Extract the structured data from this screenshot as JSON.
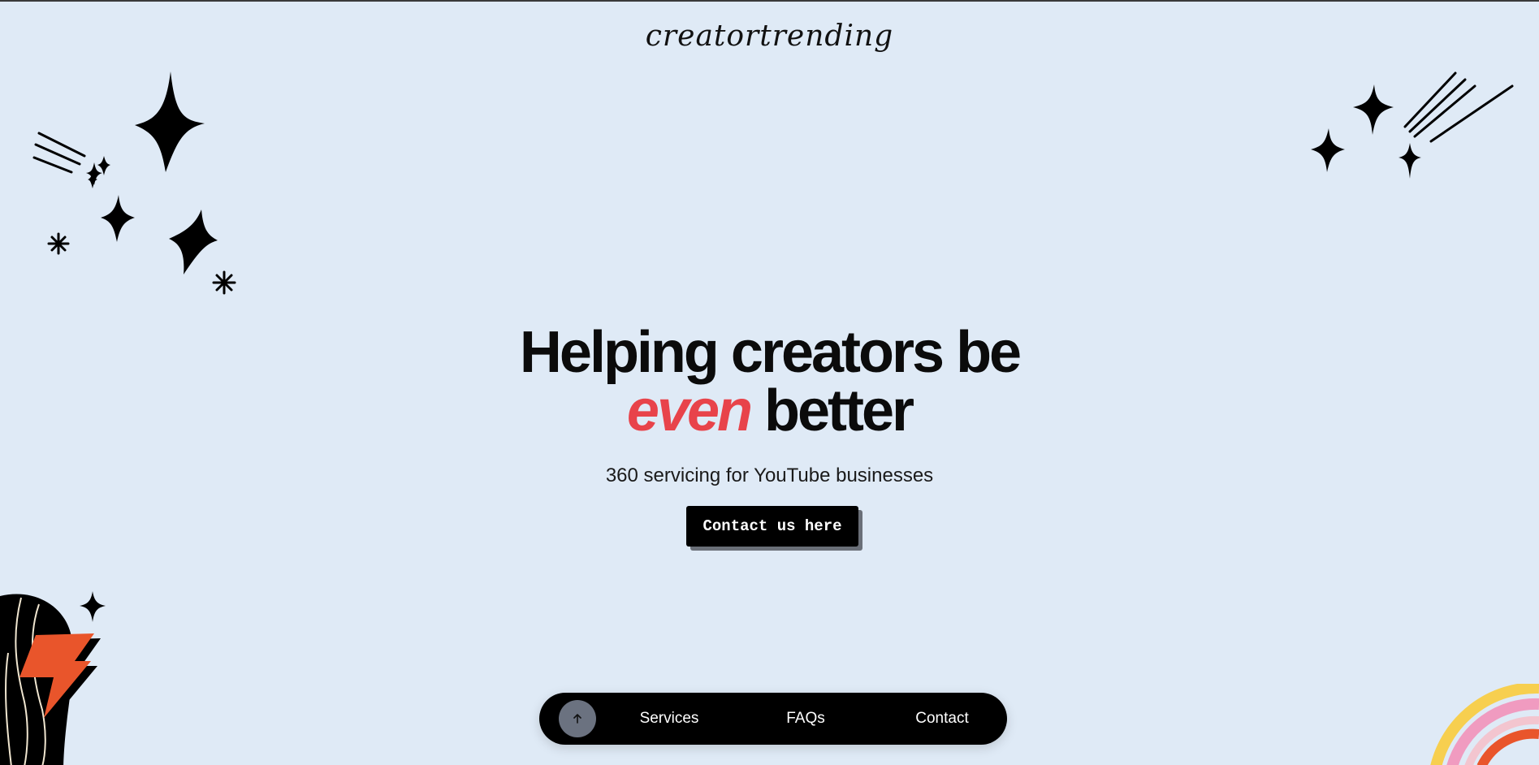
{
  "brand": {
    "logo_text": "creatortrending"
  },
  "hero": {
    "headline_line1": "Helping creators be",
    "headline_accent": "even",
    "headline_line2_rest": "better",
    "subtitle": "360 servicing for YouTube businesses",
    "cta_label": "Contact us here"
  },
  "nav": {
    "scroll_top_icon": "arrow-up-icon",
    "items": [
      {
        "label": "Services"
      },
      {
        "label": "FAQs"
      },
      {
        "label": "Contact"
      }
    ]
  },
  "colors": {
    "background": "#dfeaf6",
    "accent": "#e8434a",
    "navbar": "#000000",
    "cta_shadow": "#6a6f78",
    "lightning": "#e9552b"
  },
  "decorations": [
    "sparkles-top-left",
    "sparkles-top-right",
    "lightning-blob-bottom-left",
    "rainbow-bottom-right"
  ]
}
